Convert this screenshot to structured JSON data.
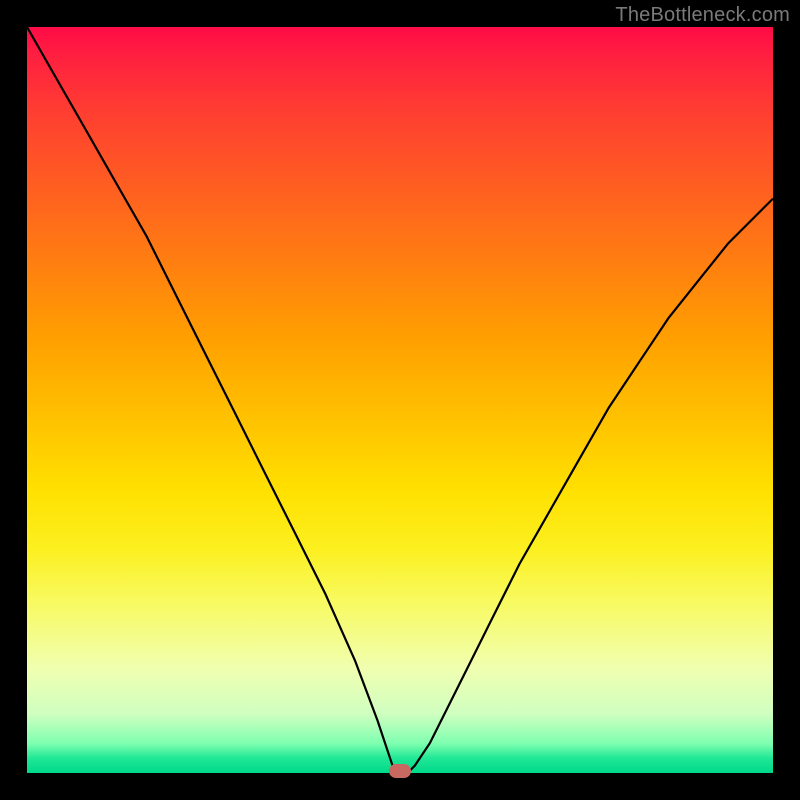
{
  "watermark": "TheBottleneck.com",
  "chart_data": {
    "type": "line",
    "title": "",
    "xlabel": "",
    "ylabel": "",
    "xlim": [
      0,
      100
    ],
    "ylim": [
      0,
      100
    ],
    "x": [
      0,
      4,
      8,
      12,
      16,
      20,
      24,
      28,
      32,
      36,
      40,
      44,
      47,
      49,
      50,
      51,
      52,
      54,
      58,
      62,
      66,
      70,
      74,
      78,
      82,
      86,
      90,
      94,
      98,
      100
    ],
    "values": [
      100,
      93,
      86,
      79,
      72,
      64,
      56,
      48,
      40,
      32,
      24,
      15,
      7,
      1,
      0,
      0,
      1,
      4,
      12,
      20,
      28,
      35,
      42,
      49,
      55,
      61,
      66,
      71,
      75,
      77
    ],
    "marker": {
      "x": 50,
      "y": 0
    },
    "gradient_stops": [
      {
        "pos": 0,
        "color": "#ff0b46"
      },
      {
        "pos": 50,
        "color": "#ffd000"
      },
      {
        "pos": 100,
        "color": "#00d88a"
      }
    ]
  }
}
